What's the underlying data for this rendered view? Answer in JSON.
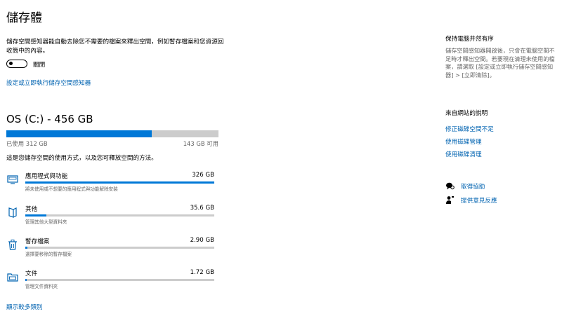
{
  "page": {
    "title": "儲存體",
    "description": "儲存空間感知器能自動去除您不需要的檔案來釋出空間，例如暫存檔案和您資源回收筒中的內容。",
    "toggle_label": "關閉",
    "toggle_on": false,
    "configure_link": "設定或立即執行儲存空間感知器"
  },
  "drive": {
    "title": "OS (C:) - 456 GB",
    "used_label": "已使用 312 GB",
    "available_label": "143 GB 可用",
    "used_fraction": 0.684,
    "explain": "這是您儲存空間的使用方式，以及您可釋放空間的方法。",
    "categories": [
      {
        "name": "應用程式與功能",
        "size": "326 GB",
        "sub": "將未使用或不想要的應用程式與功能解除安裝",
        "fraction": 1.0,
        "icon": "monitor-icon"
      },
      {
        "name": "其他",
        "size": "35.6 GB",
        "sub": "管理其他大型資料夾",
        "fraction": 0.11,
        "icon": "book-icon"
      },
      {
        "name": "暫存檔案",
        "size": "2.90 GB",
        "sub": "選擇要移除的暫存檔案",
        "fraction": 0.01,
        "icon": "trash-icon"
      },
      {
        "name": "文件",
        "size": "1.72 GB",
        "sub": "管理文件資料夾",
        "fraction": 0.006,
        "icon": "folder-icon"
      }
    ],
    "show_more": "顯示較多類別"
  },
  "sidebar": {
    "keep_heading": "保持電腦井然有序",
    "keep_text": "儲存空間感知器開啟後，只會在電腦空間不足時才釋出空間。若要現在清理未使用的檔案，請選取 [設定或立即執行儲存空間感知器] > [立即清除]。",
    "web_heading": "來自網站的說明",
    "web_links": [
      "修正磁碟空間不足",
      "使用磁碟管理",
      "使用磁碟清理"
    ],
    "get_help": "取得協助",
    "feedback": "提供意見反應"
  },
  "colors": {
    "accent": "#0078d7",
    "link": "#0063b1",
    "bar_bg": "#cccccc"
  }
}
